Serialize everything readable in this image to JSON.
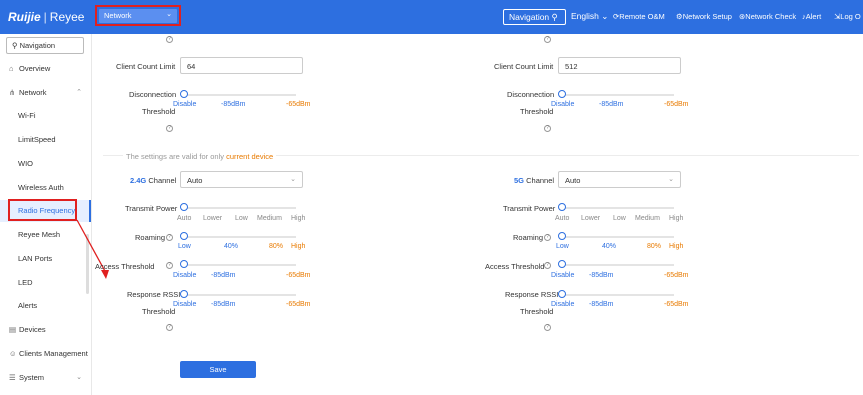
{
  "header": {
    "logo": "Ruijie",
    "brand": "Reyee",
    "network_select": "Network",
    "navigation": "Navigation",
    "language": "English",
    "remote_om": "Remote O&M",
    "network_setup": "Network Setup",
    "network_check": "Network Check",
    "alert": "Alert",
    "logout": "Log O"
  },
  "sidebar": {
    "search_placeholder": "Navigation",
    "items": [
      {
        "label": "Overview",
        "icon": "home-icon"
      },
      {
        "label": "Network",
        "icon": "network-icon"
      },
      {
        "label": "Wi-Fi"
      },
      {
        "label": "LimitSpeed"
      },
      {
        "label": "WIO"
      },
      {
        "label": "Wireless Auth"
      },
      {
        "label": "Radio Frequency"
      },
      {
        "label": "Reyee Mesh"
      },
      {
        "label": "LAN Ports"
      },
      {
        "label": "LED"
      },
      {
        "label": "Alerts"
      },
      {
        "label": "Devices",
        "icon": "devices-icon"
      },
      {
        "label": "Clients Management",
        "icon": "clients-icon"
      },
      {
        "label": "System",
        "icon": "system-icon"
      }
    ]
  },
  "labels": {
    "client_count_limit": "Client Count Limit",
    "disconnection": "Disconnection",
    "threshold": "Threshold",
    "channel": "Channel",
    "transmit_power": "Transmit Power",
    "roaming": "Roaming",
    "access_threshold": "Access Threshold",
    "response_rssi": "Response RSSI",
    "help": "?"
  },
  "note": {
    "prefix": "The settings are valid for only",
    "highlight": "current device"
  },
  "scales": {
    "rssi": [
      "Disable",
      "-85dBm",
      "-65dBm"
    ],
    "power": [
      "Auto",
      "Lower",
      "Low",
      "Medium",
      "High"
    ],
    "roaming": [
      "Low",
      "40%",
      "80%",
      "High"
    ]
  },
  "bands": [
    {
      "band": "2.4G",
      "client_count_limit": "64",
      "channel": "Auto"
    },
    {
      "band": "5G",
      "client_count_limit": "512",
      "channel": "Auto"
    }
  ],
  "save": "Save",
  "colors": {
    "primary": "#2d6fe0",
    "accent": "#e87a00",
    "highlight_box": "#e02020"
  }
}
